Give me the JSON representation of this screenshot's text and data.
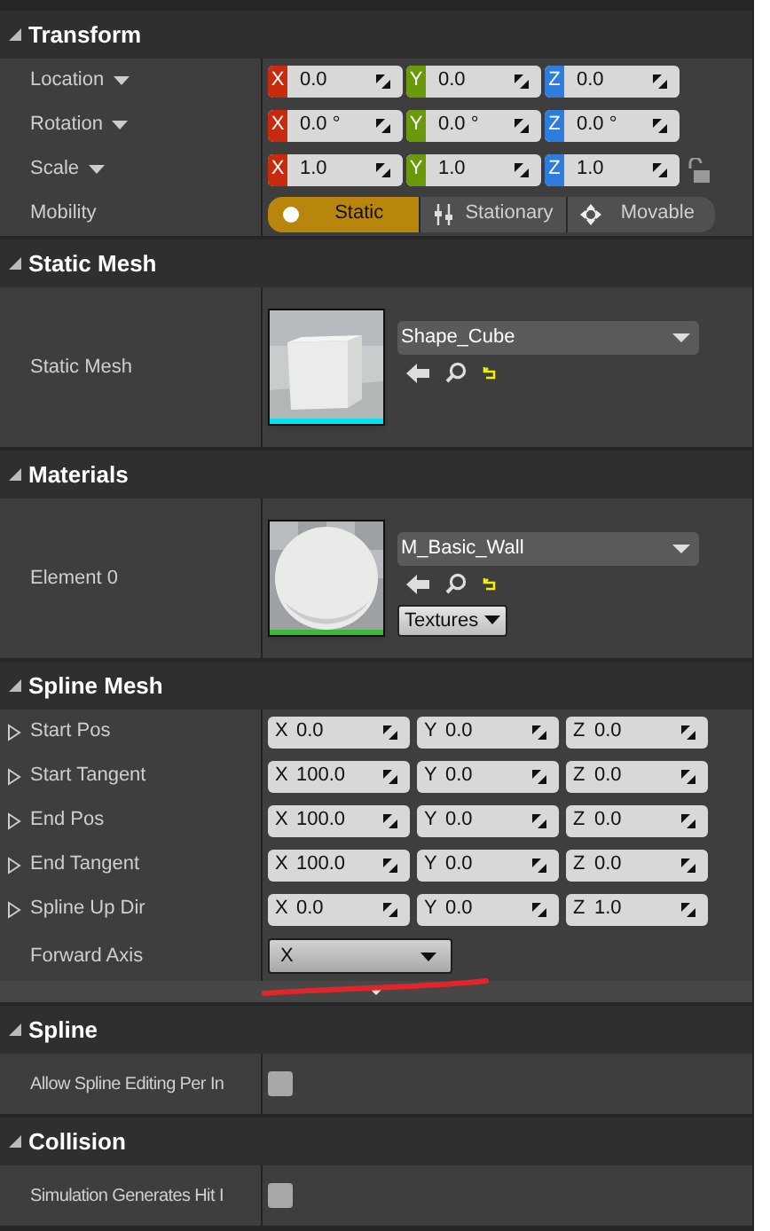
{
  "sections": [
    {
      "title": "Transform",
      "expanded": true,
      "rows": [
        {
          "kind": "color_vector",
          "label": "Location",
          "menu": true,
          "fields": [
            {
              "axis": "X",
              "value": "0.0"
            },
            {
              "axis": "Y",
              "value": "0.0"
            },
            {
              "axis": "Z",
              "value": "0.0"
            }
          ]
        },
        {
          "kind": "color_vector",
          "label": "Rotation",
          "menu": true,
          "fields": [
            {
              "axis": "X",
              "value": "0.0 °"
            },
            {
              "axis": "Y",
              "value": "0.0 °"
            },
            {
              "axis": "Z",
              "value": "0.0 °"
            }
          ]
        },
        {
          "kind": "color_vector",
          "label": "Scale",
          "menu": true,
          "locked": false,
          "fields": [
            {
              "axis": "X",
              "value": "1.0"
            },
            {
              "axis": "Y",
              "value": "1.0"
            },
            {
              "axis": "Z",
              "value": "1.0"
            }
          ]
        },
        {
          "kind": "mobility",
          "label": "Mobility",
          "options": [
            {
              "label": "Static",
              "selected": true
            },
            {
              "label": "Stationary",
              "selected": false
            },
            {
              "label": "Movable",
              "selected": false
            }
          ]
        }
      ]
    },
    {
      "title": "Static Mesh",
      "expanded": true,
      "rows": [
        {
          "kind": "asset",
          "label": "Static Mesh",
          "asset": "Shape_Cube",
          "color": "#00e5f0"
        }
      ]
    },
    {
      "title": "Materials",
      "expanded": true,
      "rows": [
        {
          "kind": "asset",
          "label": "Element 0",
          "asset": "M_Basic_Wall",
          "color": "#3cb83c",
          "button": "Textures"
        }
      ]
    },
    {
      "title": "Spline Mesh",
      "expanded": true,
      "more": true,
      "rows": [
        {
          "kind": "vector",
          "label": "Start Pos",
          "expanded": false,
          "fields": [
            {
              "axis": "X",
              "value": "0.0"
            },
            {
              "axis": "Y",
              "value": "0.0"
            },
            {
              "axis": "Z",
              "value": "0.0"
            }
          ]
        },
        {
          "kind": "vector",
          "label": "Start Tangent",
          "expanded": false,
          "fields": [
            {
              "axis": "X",
              "value": "100.0"
            },
            {
              "axis": "Y",
              "value": "0.0"
            },
            {
              "axis": "Z",
              "value": "0.0"
            }
          ]
        },
        {
          "kind": "vector",
          "label": "End Pos",
          "expanded": false,
          "fields": [
            {
              "axis": "X",
              "value": "100.0"
            },
            {
              "axis": "Y",
              "value": "0.0"
            },
            {
              "axis": "Z",
              "value": "0.0"
            }
          ]
        },
        {
          "kind": "vector",
          "label": "End Tangent",
          "expanded": false,
          "fields": [
            {
              "axis": "X",
              "value": "100.0"
            },
            {
              "axis": "Y",
              "value": "0.0"
            },
            {
              "axis": "Z",
              "value": "0.0"
            }
          ]
        },
        {
          "kind": "vector",
          "label": "Spline Up Dir",
          "expanded": false,
          "fields": [
            {
              "axis": "X",
              "value": "0.0"
            },
            {
              "axis": "Y",
              "value": "0.0"
            },
            {
              "axis": "Z",
              "value": "1.0"
            }
          ]
        },
        {
          "kind": "combo",
          "label": "Forward Axis",
          "value": "X",
          "annotated": true
        }
      ]
    },
    {
      "title": "Spline",
      "expanded": true,
      "rows": [
        {
          "kind": "checkbox",
          "label": "Allow Spline Editing Per In",
          "checked": false
        }
      ]
    },
    {
      "title": "Collision",
      "expanded": true,
      "rows": [
        {
          "kind": "checkbox",
          "label": "Simulation Generates Hit I",
          "checked": false
        }
      ]
    }
  ]
}
